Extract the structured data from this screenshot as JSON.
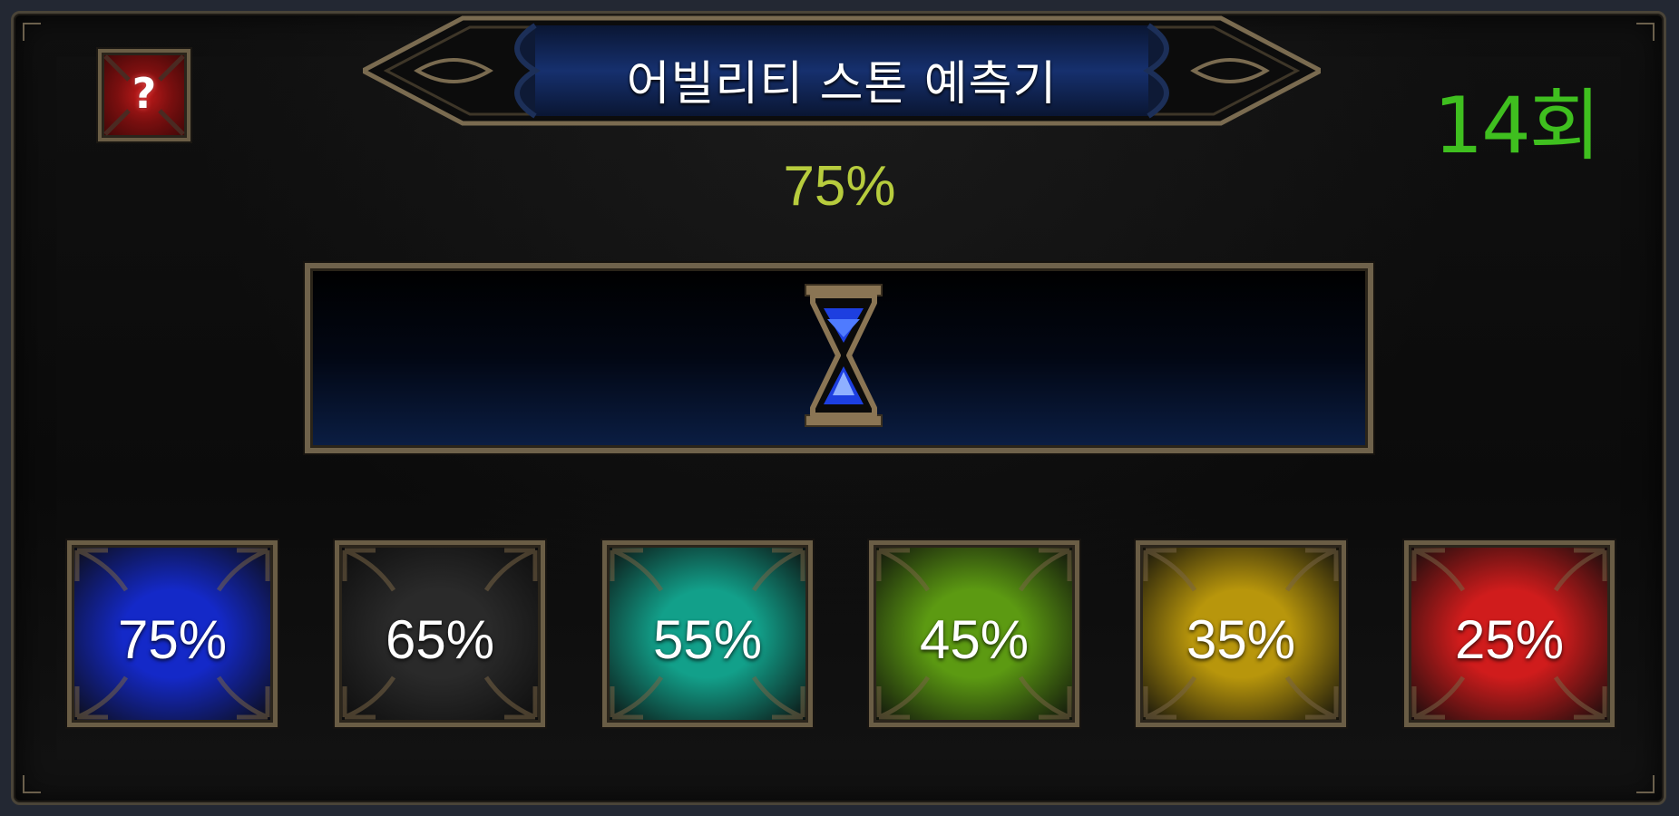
{
  "header": {
    "title": "어빌리티 스톤 예측기",
    "help_symbol": "?",
    "counter": "14회"
  },
  "current_probability": "75%",
  "status": {
    "icon": "hourglass-icon"
  },
  "probability_buttons": [
    {
      "label": "75%",
      "color": "#1429c8"
    },
    {
      "label": "65%",
      "color": "#2a2a2a"
    },
    {
      "label": "55%",
      "color": "#12a08a"
    },
    {
      "label": "45%",
      "color": "#5c9a12"
    },
    {
      "label": "35%",
      "color": "#b8960c"
    },
    {
      "label": "25%",
      "color": "#d01c1c"
    }
  ],
  "colors": {
    "counter": "#3fbf1f",
    "current_probability": "#b7cc3d",
    "frame": "#6f624b",
    "help": "#c21a1a"
  }
}
